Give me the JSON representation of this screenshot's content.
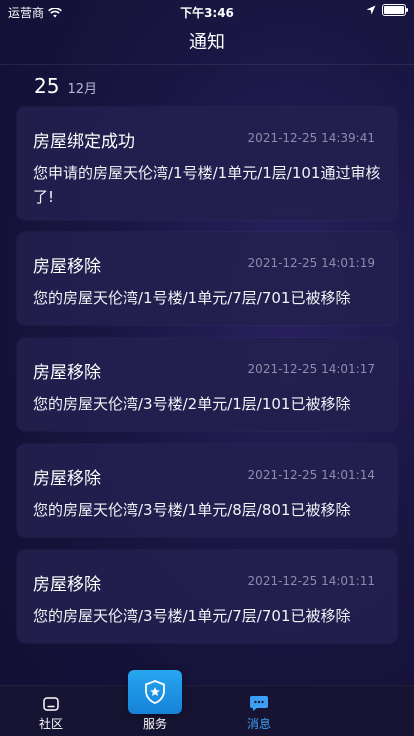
{
  "status_bar": {
    "carrier": "运营商",
    "time": "下午3:46",
    "wifi_icon": "wifi-icon",
    "location_icon": "location-arrow-icon",
    "battery_icon": "battery-icon"
  },
  "nav": {
    "title": "通知"
  },
  "date_group": {
    "day": "25",
    "month": "12月"
  },
  "notifications": [
    {
      "title": "房屋绑定成功",
      "time": "2021-12-25 14:39:41",
      "text": "您申请的房屋天伦湾/1号楼/1单元/1层/101通过审核了!"
    },
    {
      "title": "房屋移除",
      "time": "2021-12-25 14:01:19",
      "text": "您的房屋天伦湾/1号楼/1单元/7层/701已被移除"
    },
    {
      "title": "房屋移除",
      "time": "2021-12-25 14:01:17",
      "text": "您的房屋天伦湾/3号楼/2单元/1层/101已被移除"
    },
    {
      "title": "房屋移除",
      "time": "2021-12-25 14:01:14",
      "text": "您的房屋天伦湾/3号楼/1单元/8层/801已被移除"
    },
    {
      "title": "房屋移除",
      "time": "2021-12-25 14:01:11",
      "text": "您的房屋天伦湾/3号楼/1单元/7层/701已被移除"
    }
  ],
  "tabbar": {
    "community": {
      "label": "社区",
      "icon": "community-icon"
    },
    "service": {
      "label": "服务",
      "icon": "shield-star-icon"
    },
    "messages": {
      "label": "消息",
      "icon": "chat-icon"
    },
    "colors": {
      "active": "#3c9ff5",
      "inactive": "#ffffff",
      "center_button": "#1f95e6"
    }
  }
}
